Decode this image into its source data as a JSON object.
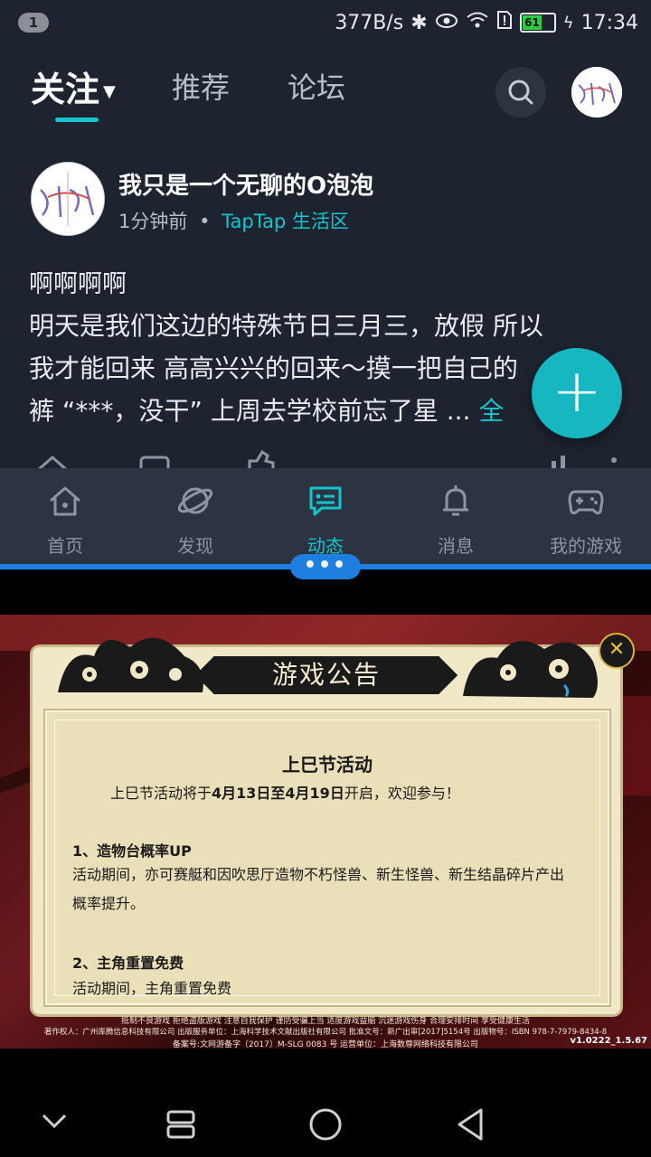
{
  "status_bar": {
    "notification_count": "1",
    "net_speed": "377B/s",
    "battery": "61",
    "time": "17:34"
  },
  "top_tabs": [
    {
      "label": "关注"
    },
    {
      "label": "推荐"
    },
    {
      "label": "论坛"
    }
  ],
  "post": {
    "author": "我只是一个无聊的O泡泡",
    "time": "1分钟前",
    "separator": "•",
    "section": "TapTap 生活区",
    "title": "啊啊啊啊",
    "body_line1": "明天是我们这边的特殊节日三月三，放假 所以",
    "body_line2": "我才能回来 高高兴兴的回来～摸一把自己的",
    "body_line3": "裤 “***，没干” 上周去学校前忘了星 ... ",
    "more_label": "全"
  },
  "fab": {
    "label": "+"
  },
  "bottom_nav": [
    {
      "label": "首页",
      "icon": "home-icon"
    },
    {
      "label": "发现",
      "icon": "planet-icon"
    },
    {
      "label": "动态",
      "icon": "message-icon"
    },
    {
      "label": "消息",
      "icon": "bell-icon"
    },
    {
      "label": "我的游戏",
      "icon": "gamepad-icon"
    }
  ],
  "split_handle": "•••",
  "game_notice": {
    "header": "游戏公告",
    "title": "上巳节活动",
    "intro_a": "上巳节活动将于",
    "intro_b": "4月13日至4月19日",
    "intro_c": "开启，欢迎参与！",
    "section1_title": "1、造物台概率UP",
    "section1_line1": "活动期间，亦可赛艇和因吹思厅造物不朽怪兽、新生怪兽、新生结晶碎片产出",
    "section1_line2": "概率提升。",
    "section2_title": "2、主角重置免费",
    "section2_line1": "活动期间，主角重置免费",
    "close": "✕"
  },
  "game_footer": {
    "line1": "抵制不良游戏 拒绝盗版游戏 注意自我保护 谨防受骗上当 适度游戏益脑 沉迷游戏伤身 合理安排时间 享受健康生活",
    "line2": "著作权人：广州库腾信息科技有限公司 出版服务单位：上海科学技术文献出版社有限公司 批准文号：新广出审[2017]5154号 出版物号：ISBN 978-7-7979-8434-8",
    "line3": "备案号:文网游备字〔2017〕M-SLG 0083 号 运营单位：上海数尊网络科技有限公司",
    "version": "v1.0222_1.5.67"
  },
  "colors": {
    "app_bg": "#1d2430",
    "accent": "#15c5ce",
    "nav_bg": "#2c3442",
    "split": "#1f7fe0"
  }
}
